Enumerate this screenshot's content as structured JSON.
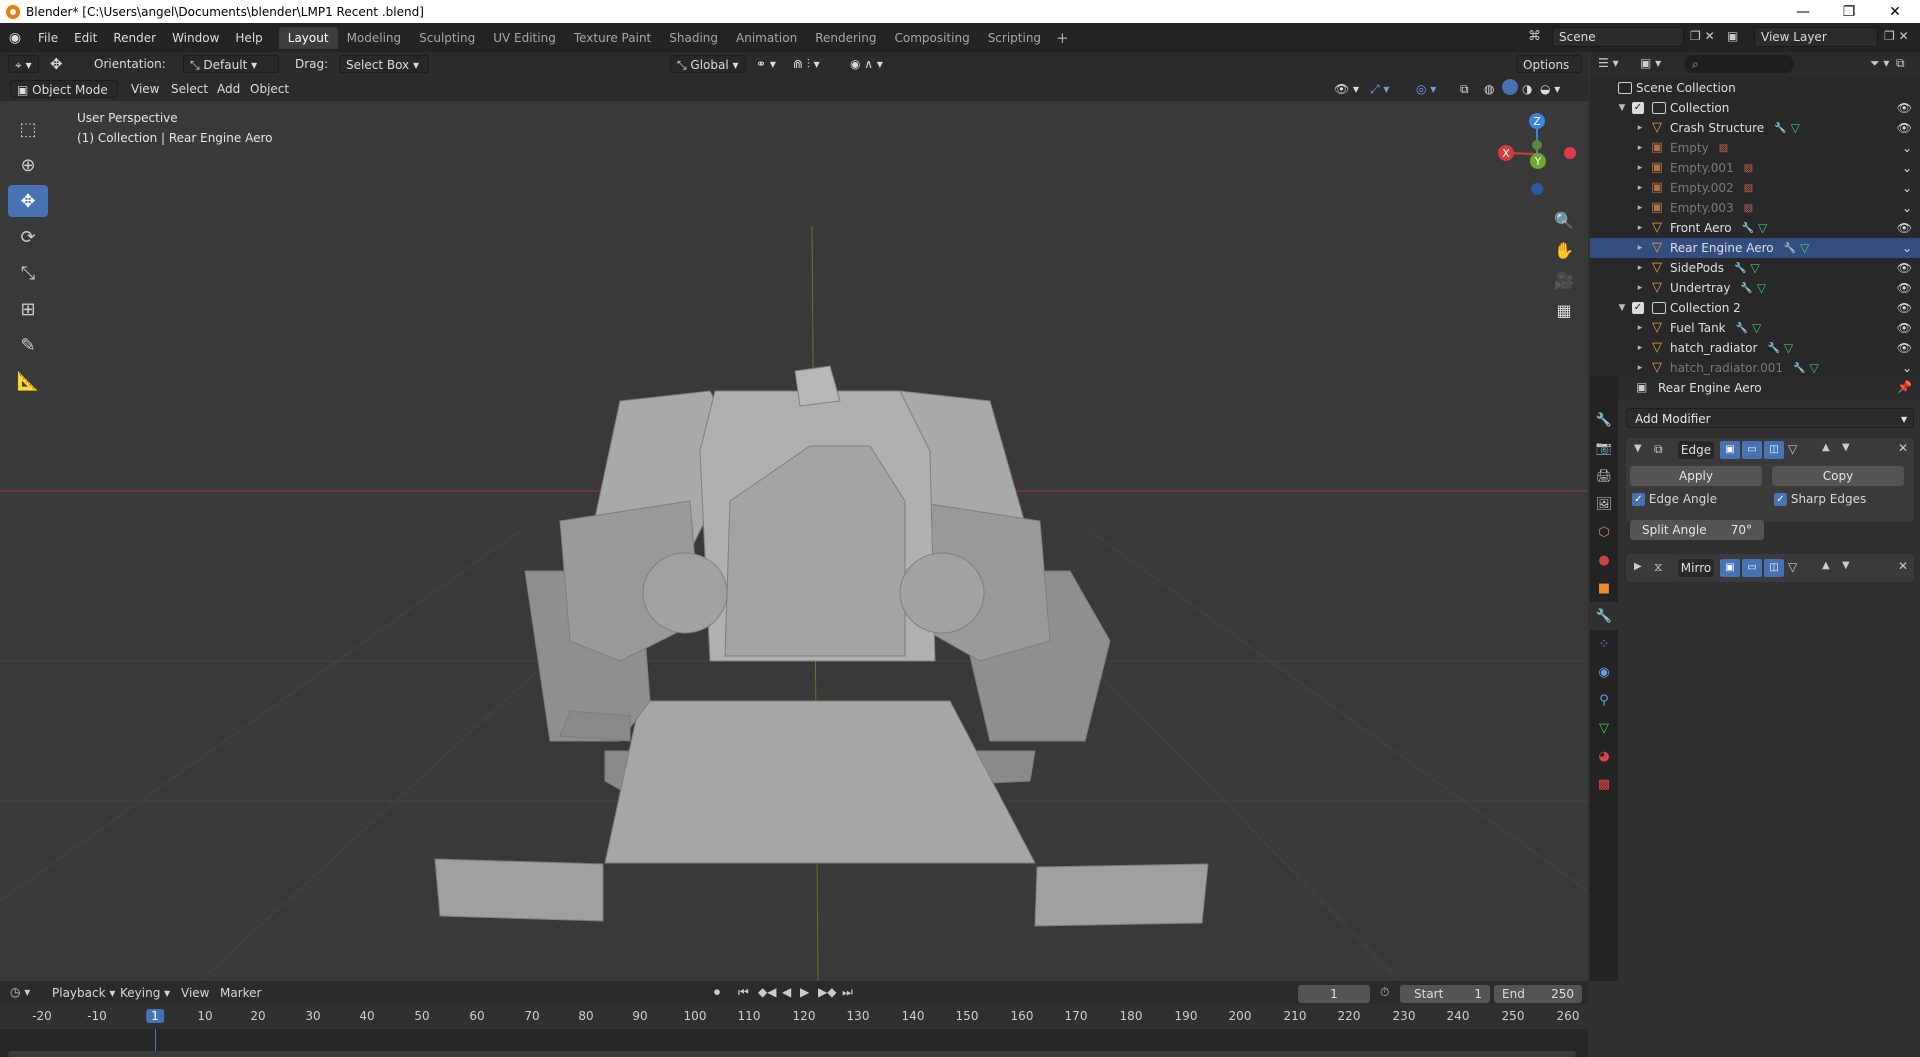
{
  "window": {
    "title": "Blender* [C:\\Users\\angel\\Documents\\blender\\LMP1 Recent .blend]",
    "minimize": "—",
    "restore": "❐",
    "close": "✕"
  },
  "menu": [
    "File",
    "Edit",
    "Render",
    "Window",
    "Help"
  ],
  "workspaces": [
    "Layout",
    "Modeling",
    "Sculpting",
    "UV Editing",
    "Texture Paint",
    "Shading",
    "Animation",
    "Rendering",
    "Compositing",
    "Scripting"
  ],
  "workspace_active": "Layout",
  "add_workspace": "+",
  "scene": "Scene",
  "view_layer": "View Layer",
  "header": {
    "orientation_label": "Orientation:",
    "orientation_value": "Default",
    "drag_label": "Drag:",
    "drag_value": "Select Box",
    "transform_space": "Global",
    "options": "Options"
  },
  "header2": {
    "mode": "Object Mode",
    "menus": [
      "View",
      "Select",
      "Add",
      "Object"
    ]
  },
  "viewport": {
    "perspective": "User Perspective",
    "collection_info": "(1) Collection | Rear Engine Aero",
    "gizmo": {
      "z": "Z",
      "x": "X",
      "y": "Y"
    }
  },
  "outliner": {
    "root": "Scene Collection",
    "rows": [
      {
        "name": "Collection",
        "type": "collection",
        "indent": 1,
        "dim": false,
        "selected": false
      },
      {
        "name": "Crash Structure",
        "type": "mesh",
        "indent": 2,
        "dim": false,
        "selected": false
      },
      {
        "name": "Empty",
        "type": "empty",
        "indent": 2,
        "dim": true,
        "selected": false
      },
      {
        "name": "Empty.001",
        "type": "empty",
        "indent": 2,
        "dim": true,
        "selected": false
      },
      {
        "name": "Empty.002",
        "type": "empty",
        "indent": 2,
        "dim": true,
        "selected": false
      },
      {
        "name": "Empty.003",
        "type": "empty",
        "indent": 2,
        "dim": true,
        "selected": false
      },
      {
        "name": "Front Aero",
        "type": "mesh",
        "indent": 2,
        "dim": false,
        "selected": false
      },
      {
        "name": "Rear Engine Aero",
        "type": "mesh",
        "indent": 2,
        "dim": true,
        "selected": true
      },
      {
        "name": "SidePods",
        "type": "mesh",
        "indent": 2,
        "dim": false,
        "selected": false
      },
      {
        "name": "Undertray",
        "type": "mesh",
        "indent": 2,
        "dim": false,
        "selected": false
      },
      {
        "name": "Collection 2",
        "type": "collection",
        "indent": 1,
        "dim": false,
        "selected": false
      },
      {
        "name": "Fuel Tank",
        "type": "mesh",
        "indent": 2,
        "dim": false,
        "selected": false
      },
      {
        "name": "hatch_radiator",
        "type": "mesh",
        "indent": 2,
        "dim": false,
        "selected": false
      },
      {
        "name": "hatch_radiator.001",
        "type": "mesh",
        "indent": 2,
        "dim": true,
        "selected": false
      }
    ]
  },
  "properties": {
    "object_name": "Rear Engine Aero",
    "add_modifier": "Add Modifier",
    "modifier1": {
      "name": "Edge",
      "apply": "Apply",
      "copy": "Copy",
      "edge_angle": "Edge Angle",
      "sharp_edges": "Sharp Edges",
      "split_angle_label": "Split Angle",
      "split_angle_value": "70°"
    },
    "modifier2": {
      "name": "Mirro"
    }
  },
  "timeline": {
    "menus": [
      "Playback",
      "Keying",
      "View",
      "Marker"
    ],
    "current_frame": "1",
    "start_label": "Start",
    "start_value": "1",
    "end_label": "End",
    "end_value": "250",
    "ticks": [
      "-20",
      "-10",
      "1",
      "10",
      "20",
      "30",
      "40",
      "50",
      "60",
      "70",
      "80",
      "90",
      "100",
      "110",
      "120",
      "130",
      "140",
      "150",
      "160",
      "170",
      "180",
      "190",
      "200",
      "210",
      "220",
      "230",
      "240",
      "250",
      "260"
    ]
  }
}
